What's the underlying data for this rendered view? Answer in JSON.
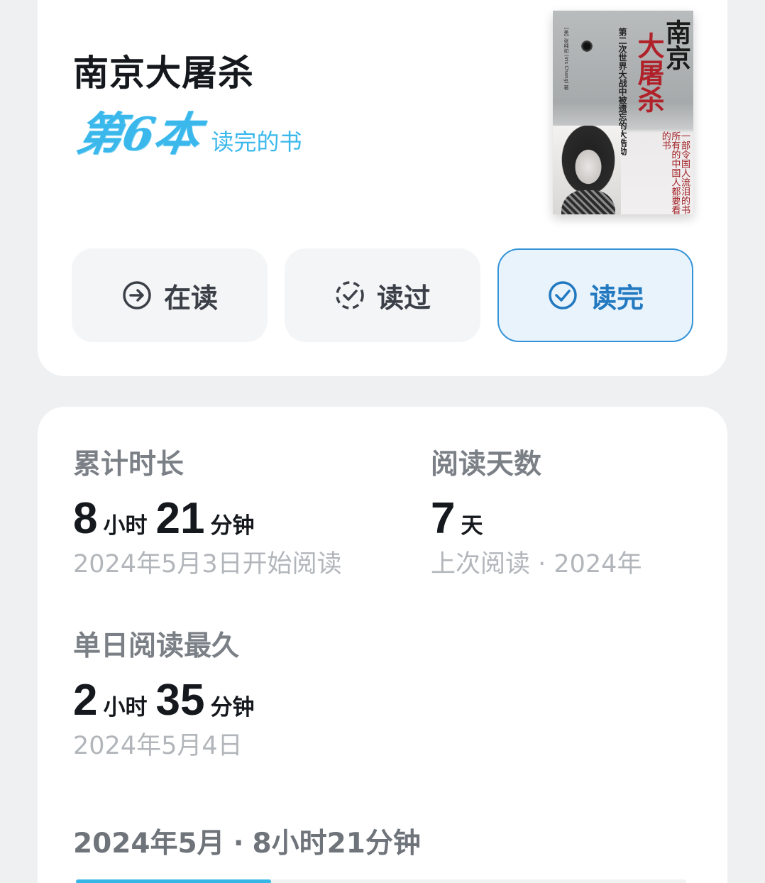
{
  "book": {
    "title": "南京大屠杀",
    "rank_badge": "第6本",
    "rank_caption": "读完的书",
    "cover": {
      "title_black": "南京",
      "title_red": "大屠杀",
      "subtitle": "第二次世界大战中被遗忘的大浩劫",
      "blurb": "一部令国人流泪的书所有的中国人都要看的书",
      "author": "[美] 张纯如 (Iris Chang) 著"
    }
  },
  "status_buttons": [
    {
      "label": "在读",
      "icon": "arrow-circle-icon",
      "active": false
    },
    {
      "label": "读过",
      "icon": "dashed-check-circle-icon",
      "active": false
    },
    {
      "label": "读完",
      "icon": "check-circle-icon",
      "active": true
    }
  ],
  "stats": {
    "total": {
      "label": "累计时长",
      "hours": "8",
      "hours_unit": "小时",
      "minutes": "21",
      "minutes_unit": "分钟",
      "sub": "2024年5月3日开始阅读"
    },
    "days": {
      "label": "阅读天数",
      "value": "7",
      "unit": "天",
      "sub": "上次阅读 · 2024年"
    },
    "max_day": {
      "label": "单日阅读最久",
      "hours": "2",
      "hours_unit": "小时",
      "minutes": "35",
      "minutes_unit": "分钟",
      "sub": "2024年5月4日"
    }
  },
  "month": {
    "label": "2024年5月",
    "separator": "·",
    "duration": "8小时21分钟",
    "progress": 0.32
  },
  "colors": {
    "accent_blue": "#3494d8",
    "badge_cyan": "#3ab8ec",
    "cover_red": "#b0212a"
  }
}
